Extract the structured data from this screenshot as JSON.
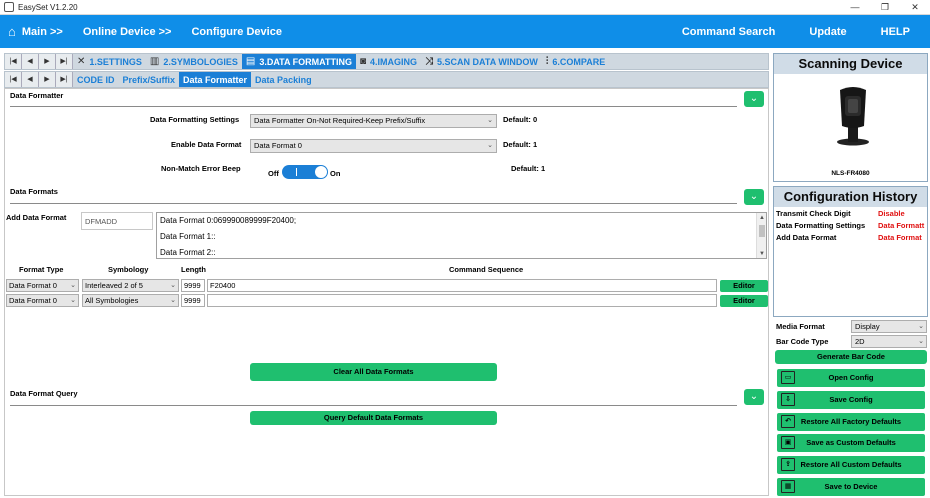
{
  "window": {
    "title": "EasySet V1.2.20",
    "minimize": "—",
    "restore": "❐",
    "close": "✕"
  },
  "nav": {
    "home_icon": "⌂",
    "main": "Main >>",
    "online_device": "Online Device >>",
    "configure_device": "Configure Device",
    "command_search": "Command Search",
    "update": "Update",
    "help": "HELP"
  },
  "tabs": [
    {
      "label": "1.SETTINGS",
      "icon": "wrench-icon"
    },
    {
      "label": "2.SYMBOLOGIES",
      "icon": "barcode-icon"
    },
    {
      "label": "3.DATA FORMATTING",
      "icon": "format-icon"
    },
    {
      "label": "4.IMAGING",
      "icon": "camera-icon"
    },
    {
      "label": "5.SCAN DATA WINDOW",
      "icon": "shuffle-icon"
    },
    {
      "label": "6.COMPARE",
      "icon": "sliders-icon"
    }
  ],
  "subtabs": [
    "CODE ID",
    "Prefix/Suffix",
    "Data Formatter",
    "Data Packing"
  ],
  "data_formatter": {
    "title": "Data Formatter",
    "settings_label": "Data Formatting Settings",
    "settings_value": "Data Formatter On-Not Required-Keep Prefix/Suffix",
    "settings_default": "Default: 0",
    "enable_label": "Enable Data Format",
    "enable_value": "Data Format 0",
    "enable_default": "Default: 1",
    "beep_label": "Non-Match Error Beep",
    "beep_off": "Off",
    "beep_on": "On",
    "beep_default": "Default: 1"
  },
  "data_formats": {
    "title": "Data Formats",
    "add_label": "Add Data Format",
    "add_placeholder": "DFMADD",
    "lines": [
      "Data Format 0:069990089999F20400;",
      "Data Format 1::",
      "Data Format 2::"
    ],
    "headers": {
      "format_type": "Format Type",
      "symbology": "Symbology",
      "length": "Length",
      "command": "Command Sequence"
    },
    "rows": [
      {
        "format_type": "Data Format 0",
        "symbology": "Interleaved 2 of 5",
        "length": "9999",
        "command": "F20400",
        "editor": "Editor"
      },
      {
        "format_type": "Data Format 0",
        "symbology": "All Symbologies",
        "length": "9999",
        "command": "",
        "editor": "Editor"
      }
    ],
    "clear_button": "Clear All Data Formats"
  },
  "query": {
    "title": "Data Format Query",
    "button": "Query Default Data Formats"
  },
  "right": {
    "scanning_title": "Scanning Device",
    "device_name": "NLS-FR4080",
    "history_title": "Configuration History",
    "history": [
      {
        "key": "Transmit Check Digit",
        "value": "Disable"
      },
      {
        "key": "Data Formatting Settings",
        "value": "Data Formatt"
      },
      {
        "key": "Add Data Format",
        "value": "Data Format"
      }
    ],
    "media_format_label": "Media Format",
    "media_format_value": "Display",
    "barcode_type_label": "Bar Code Type",
    "barcode_type_value": "2D",
    "generate": "Generate Bar Code",
    "buttons": [
      "Open Config",
      "Save Config",
      "Restore All Factory Defaults",
      "Save as Custom Defaults",
      "Restore All Custom Defaults",
      "Save to Device"
    ]
  },
  "colors": {
    "nav_blue": "#0f8ee8",
    "green": "#1fbf6f",
    "tab_blue": "#1b7fd6",
    "history_red": "#e01010"
  }
}
